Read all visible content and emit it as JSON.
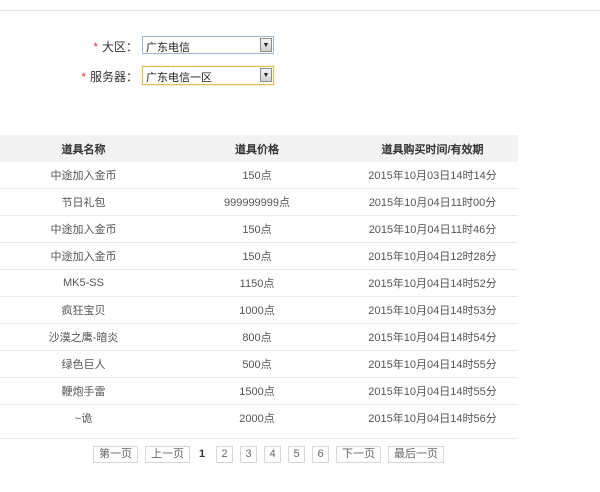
{
  "form": {
    "region": {
      "label": "大区：",
      "required_mark": "*",
      "value": "广东电信"
    },
    "server": {
      "label": "服务器：",
      "required_mark": "*",
      "value": "广东电信一区"
    }
  },
  "table": {
    "headers": [
      "道具名称",
      "道具价格",
      "道具购买时间/有效期"
    ],
    "rows": [
      [
        "中途加入金币",
        "150点",
        "2015年10月03日14时14分"
      ],
      [
        "节日礼包",
        "999999999点",
        "2015年10月04日11时00分"
      ],
      [
        "中途加入金币",
        "150点",
        "2015年10月04日11时46分"
      ],
      [
        "中途加入金币",
        "150点",
        "2015年10月04日12时28分"
      ],
      [
        "MK5-SS",
        "1150点",
        "2015年10月04日14时52分"
      ],
      [
        "疯狂宝贝",
        "1000点",
        "2015年10月04日14时53分"
      ],
      [
        "沙漠之鹰-暗炎",
        "800点",
        "2015年10月04日14时54分"
      ],
      [
        "绿色巨人",
        "500点",
        "2015年10月04日14时55分"
      ],
      [
        "鞭炮手雷",
        "1500点",
        "2015年10月04日14时55分"
      ],
      [
        "~诡",
        "2000点",
        "2015年10月04日14时56分"
      ]
    ]
  },
  "pagination": {
    "first": "第一页",
    "prev": "上一页",
    "pages": [
      "1",
      "2",
      "3",
      "4",
      "5",
      "6"
    ],
    "current": "1",
    "next": "下一页",
    "last": "最后一页"
  }
}
